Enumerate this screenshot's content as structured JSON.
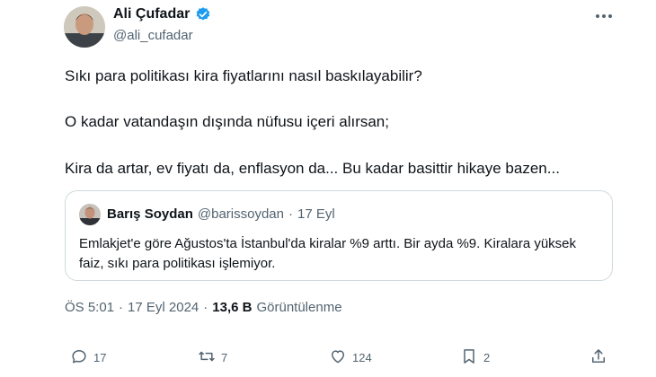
{
  "author": {
    "display_name": "Ali Çufadar",
    "handle": "@ali_cufadar",
    "verified_icon": "verified-badge-icon"
  },
  "tweet": {
    "lines": [
      "Sıkı para politikası kira fiyatlarını nasıl baskılayabilir?",
      "O kadar vatandaşın dışında nüfusu içeri alırsan;",
      "Kira da artar, ev fiyatı da, enflasyon da... Bu kadar basittir hikaye bazen..."
    ]
  },
  "quote": {
    "display_name": "Barış Soydan",
    "handle": "@barissoydan",
    "separator": "·",
    "date": "17 Eyl",
    "text": "Emlakjet'e göre Ağustos'ta İstanbul'da kiralar %9 arttı. Bir ayda %9. Kiralara yüksek faiz, sıkı para politikası işlemiyor."
  },
  "meta": {
    "time": "ÖS 5:01",
    "separator": "·",
    "date": "17 Eyl 2024",
    "views_count": "13,6 B",
    "views_label": "Görüntülenme"
  },
  "actions": {
    "replies": "17",
    "retweets": "7",
    "likes": "124",
    "bookmarks": "2"
  },
  "colors": {
    "text": "#0f1419",
    "secondary": "#536471",
    "verified": "#1d9bf0",
    "border": "#cfd9de"
  }
}
